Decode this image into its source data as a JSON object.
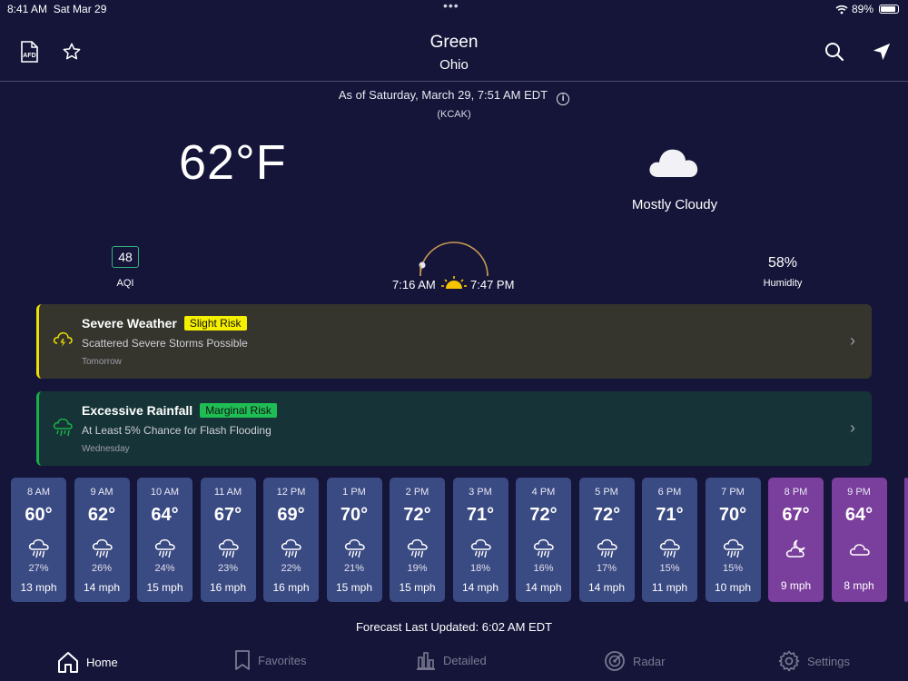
{
  "status": {
    "time": "8:41 AM",
    "date": "Sat Mar 29",
    "battery": "89%"
  },
  "header": {
    "city": "Green",
    "state": "Ohio",
    "afd_icon": "afd-document-icon",
    "favorite_icon": "star-icon",
    "search_icon": "search-icon",
    "location_icon": "location-arrow-icon"
  },
  "observation": {
    "as_of": "As of Saturday, March 29, 7:51 AM EDT",
    "station": "(KCAK)"
  },
  "current": {
    "temperature": "62°F",
    "condition": "Mostly Cloudy"
  },
  "aqi": {
    "value": "48",
    "label": "AQI",
    "color": "#2fb47a"
  },
  "sun": {
    "sunrise": "7:16 AM",
    "sunset": "7:47 PM"
  },
  "humidity": {
    "value": "58%",
    "label": "Humidity"
  },
  "alerts": [
    {
      "title": "Severe Weather",
      "risk": "Slight Risk",
      "subtitle": "Scattered Severe Storms Possible",
      "when": "Tomorrow",
      "color": "#f5ef00"
    },
    {
      "title": "Excessive Rainfall",
      "risk": "Marginal Risk",
      "subtitle": "At Least 5% Chance for Flash Flooding",
      "when": "Wednesday",
      "color": "#1fbe55"
    }
  ],
  "hourly": [
    {
      "time": "8 AM",
      "temp": "60°",
      "precip": "27%",
      "wind": "13 mph",
      "icon": "rain-icon"
    },
    {
      "time": "9 AM",
      "temp": "62°",
      "precip": "26%",
      "wind": "14 mph",
      "icon": "rain-icon"
    },
    {
      "time": "10 AM",
      "temp": "64°",
      "precip": "24%",
      "wind": "15 mph",
      "icon": "rain-icon"
    },
    {
      "time": "11 AM",
      "temp": "67°",
      "precip": "23%",
      "wind": "16 mph",
      "icon": "rain-icon"
    },
    {
      "time": "12 PM",
      "temp": "69°",
      "precip": "22%",
      "wind": "16 mph",
      "icon": "rain-icon"
    },
    {
      "time": "1 PM",
      "temp": "70°",
      "precip": "21%",
      "wind": "15 mph",
      "icon": "rain-icon"
    },
    {
      "time": "2 PM",
      "temp": "72°",
      "precip": "19%",
      "wind": "15 mph",
      "icon": "rain-icon"
    },
    {
      "time": "3 PM",
      "temp": "71°",
      "precip": "18%",
      "wind": "14 mph",
      "icon": "rain-icon"
    },
    {
      "time": "4 PM",
      "temp": "72°",
      "precip": "16%",
      "wind": "14 mph",
      "icon": "rain-icon"
    },
    {
      "time": "5 PM",
      "temp": "72°",
      "precip": "17%",
      "wind": "14 mph",
      "icon": "rain-icon"
    },
    {
      "time": "6 PM",
      "temp": "71°",
      "precip": "15%",
      "wind": "11 mph",
      "icon": "rain-icon"
    },
    {
      "time": "7 PM",
      "temp": "70°",
      "precip": "15%",
      "wind": "10 mph",
      "icon": "rain-icon"
    },
    {
      "time": "8 PM",
      "temp": "67°",
      "precip": "",
      "wind": "9 mph",
      "icon": "partly-cloudy-night-icon",
      "night": true
    },
    {
      "time": "9 PM",
      "temp": "64°",
      "precip": "",
      "wind": "8 mph",
      "icon": "cloudy-night-icon",
      "night": true
    }
  ],
  "forecast_updated": "Forecast Last Updated: 6:02 AM EDT",
  "tabs": [
    {
      "label": "Home",
      "icon": "home-icon",
      "active": true
    },
    {
      "label": "Favorites",
      "icon": "bookmark-icon"
    },
    {
      "label": "Detailed",
      "icon": "bar-chart-icon"
    },
    {
      "label": "Radar",
      "icon": "radar-icon"
    },
    {
      "label": "Settings",
      "icon": "gear-icon"
    }
  ],
  "colors": {
    "background": "#15153a",
    "day_card": "#3a4a82",
    "night_card": "#7a3e9c"
  }
}
